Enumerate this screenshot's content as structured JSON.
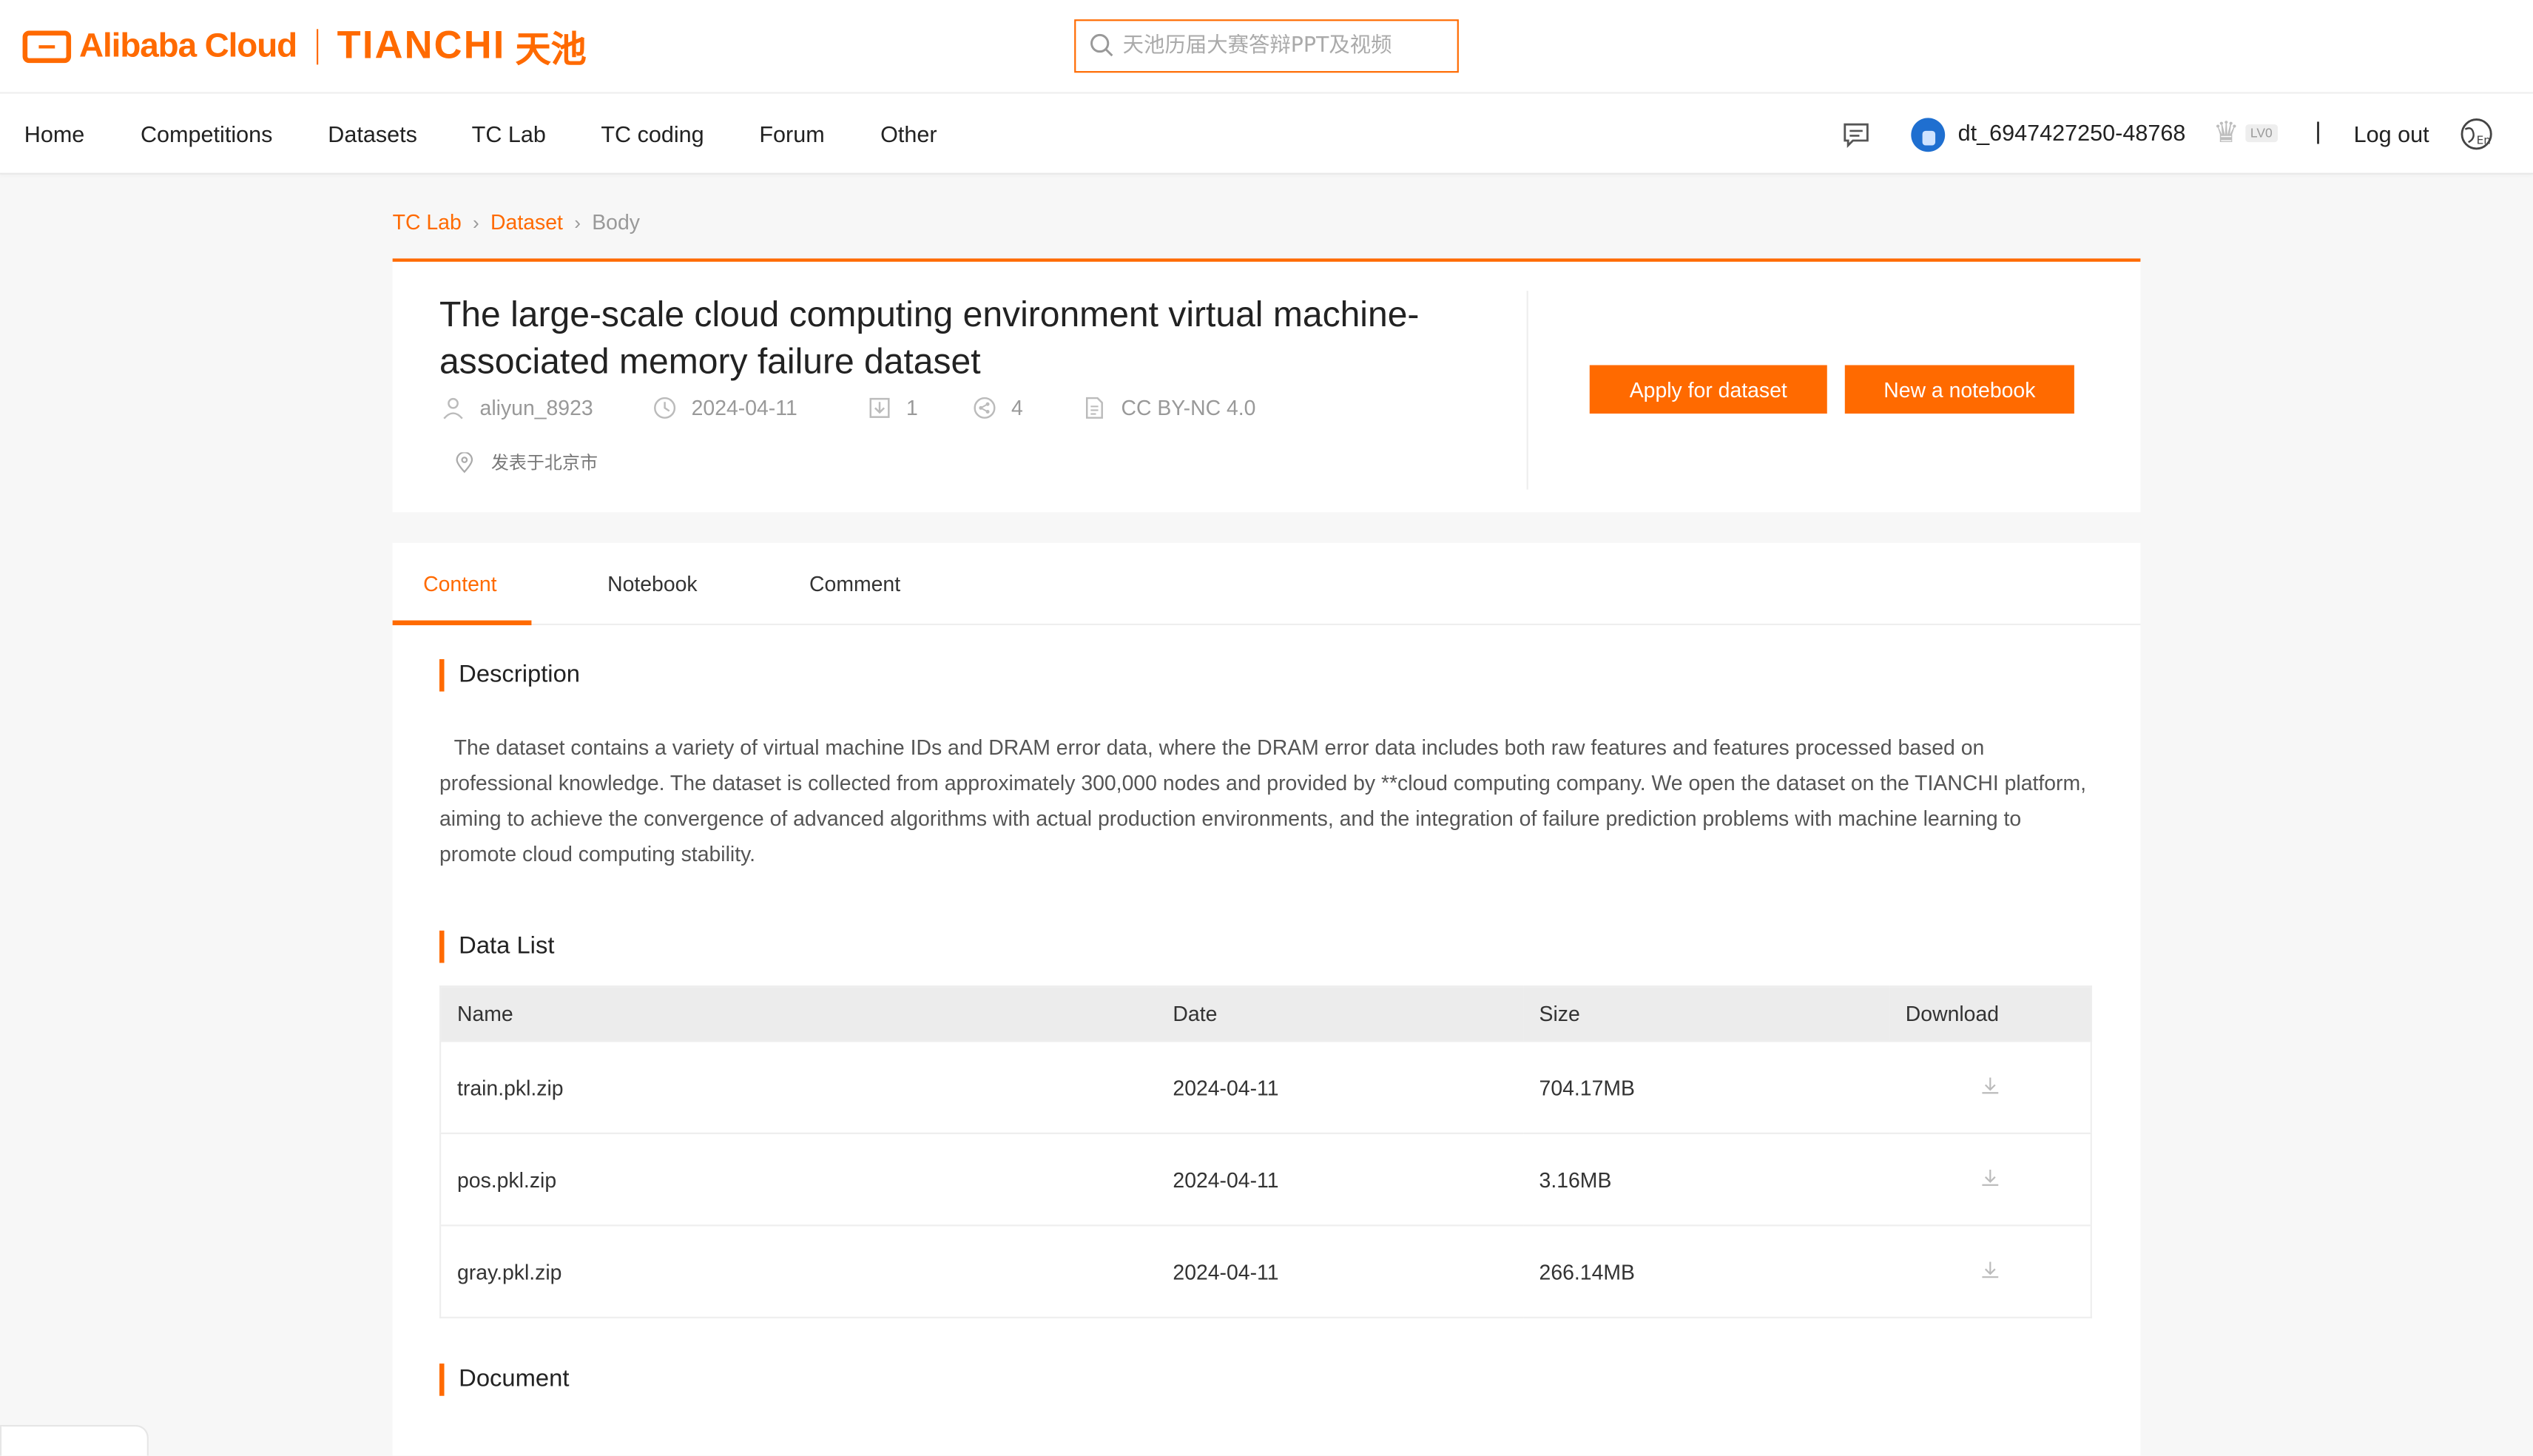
{
  "brand": {
    "alibaba": "Alibaba Cloud",
    "tianchi": "TIANCHI",
    "tianchi_cn": "天池",
    "accent_color": "#ff6a00"
  },
  "search": {
    "placeholder": "天池历届大赛答辩PPT及视频",
    "icon": "search-icon"
  },
  "nav": {
    "items": [
      "Home",
      "Competitions",
      "Datasets",
      "TC Lab",
      "TC coding",
      "Forum",
      "Other"
    ],
    "username": "dt_6947427250-48768",
    "level": "LV0",
    "separator": "|",
    "logout": "Log out",
    "icons": [
      "message-icon",
      "avatar",
      "crown-icon",
      "language-icon"
    ]
  },
  "breadcrumb": {
    "items": [
      "TC Lab",
      "Dataset"
    ],
    "current": "Body"
  },
  "dataset": {
    "title": "The large-scale cloud computing environment virtual machine-associated memory failure dataset",
    "author": "aliyun_8923",
    "date": "2024-04-11",
    "downloads": "1",
    "shares": "4",
    "license": "CC BY-NC 4.0",
    "location": "发表于北京市",
    "apply_button": "Apply for dataset",
    "notebook_button": "New a notebook"
  },
  "tabs": [
    "Content",
    "Notebook",
    "Comment"
  ],
  "description": {
    "heading": "Description",
    "text": "The dataset contains a variety of virtual machine IDs and DRAM error data, where the DRAM error data includes both raw features and features processed based on professional knowledge. The dataset is collected from approximately 300,000 nodes and provided by **cloud computing company. We open the dataset on the TIANCHI platform, aiming to achieve the convergence of advanced algorithms with actual production environments, and the integration of failure prediction problems with machine learning to promote cloud computing stability."
  },
  "data_list": {
    "heading": "Data List",
    "columns": [
      "Name",
      "Date",
      "Size",
      "Download"
    ],
    "rows": [
      {
        "name": "train.pkl.zip",
        "date": "2024-04-11",
        "size": "704.17MB"
      },
      {
        "name": "pos.pkl.zip",
        "date": "2024-04-11",
        "size": "3.16MB"
      },
      {
        "name": "gray.pkl.zip",
        "date": "2024-04-11",
        "size": "266.14MB"
      }
    ]
  },
  "document": {
    "heading": "Document"
  }
}
